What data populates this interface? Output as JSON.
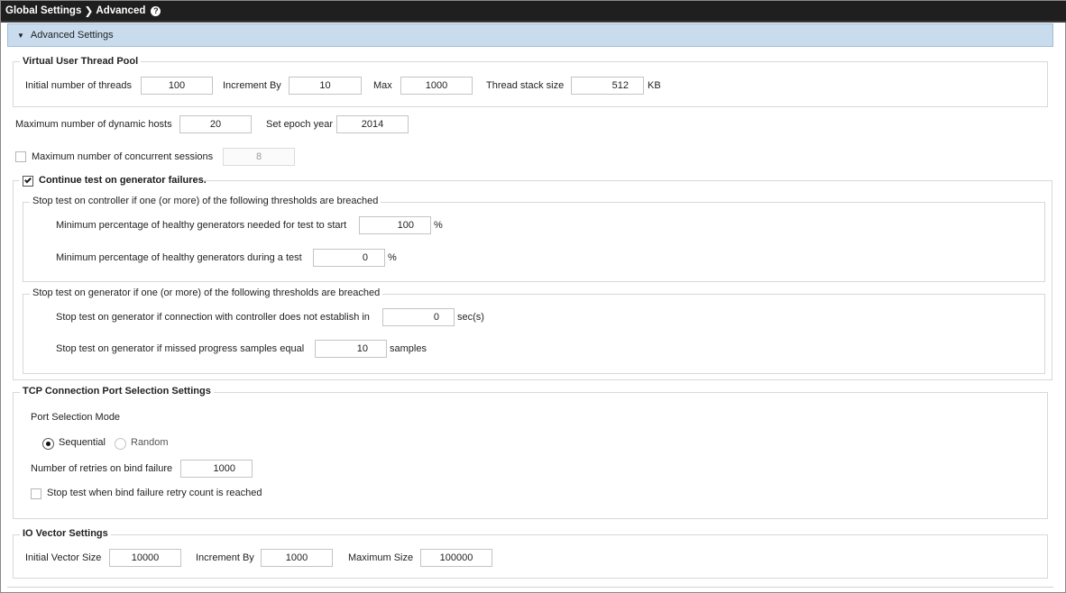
{
  "breadcrumb": {
    "root": "Global Settings",
    "current": "Advanced"
  },
  "panel": {
    "title": "Advanced Settings"
  },
  "thread_pool": {
    "legend": "Virtual User Thread Pool",
    "initial_label": "Initial number of threads",
    "initial_value": "100",
    "increment_label": "Increment By",
    "increment_value": "10",
    "max_label": "Max",
    "max_value": "1000",
    "stack_label": "Thread stack size",
    "stack_value": "512",
    "stack_unit": "KB"
  },
  "hosts": {
    "max_dynamic_label": "Maximum number of dynamic hosts",
    "max_dynamic_value": "20",
    "epoch_label": "Set epoch year",
    "epoch_value": "2014"
  },
  "sessions": {
    "label": "Maximum number of concurrent sessions",
    "value": "8",
    "checked": false
  },
  "generator": {
    "continue_label": "Continue test on generator failures.",
    "continue_checked": true,
    "controller_group": {
      "legend": "Stop test on controller if one (or more) of the following thresholds are breached",
      "start_label": "Minimum percentage of healthy generators needed for test to start",
      "start_value": "100",
      "start_unit": "%",
      "during_label": "Minimum percentage of healthy generators during a test",
      "during_value": "0",
      "during_unit": "%"
    },
    "generator_group": {
      "legend": "Stop test on generator if one (or more) of the following thresholds are breached",
      "connection_label": "Stop test on generator if connection with controller does not establish in",
      "connection_value": "0",
      "connection_unit": "sec(s)",
      "missed_label": "Stop test on generator if missed progress samples equal",
      "missed_value": "10",
      "missed_unit": "samples"
    }
  },
  "tcp": {
    "legend": "TCP Connection Port Selection Settings",
    "mode_label": "Port Selection Mode",
    "sequential_label": "Sequential",
    "random_label": "Random",
    "selected": "Sequential",
    "retries_label": "Number of retries on bind failure",
    "retries_value": "1000",
    "stop_label": "Stop test when bind failure retry count is reached",
    "stop_checked": false
  },
  "io_vector": {
    "legend": "IO Vector Settings",
    "initial_label": "Initial Vector Size",
    "initial_value": "10000",
    "increment_label": "Increment By",
    "increment_value": "1000",
    "max_label": "Maximum Size",
    "max_value": "100000"
  },
  "colors": {
    "titlebar": "#1f1f1f",
    "panel_header": "#c9dcee",
    "border": "#d8d8d8"
  }
}
